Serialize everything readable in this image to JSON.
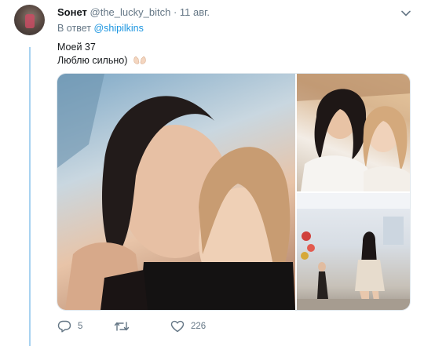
{
  "tweet": {
    "display_name": "Sонет",
    "handle": "@the_lucky_bitch",
    "dot": "·",
    "date": "11 авг.",
    "reply_prefix": "В ответ",
    "reply_handle": "@shipilkins",
    "text_line1": "Моей 37",
    "text_line2": "Люблю сильно)"
  },
  "icons": {
    "more": "chevron-down-icon",
    "reply": "reply-icon",
    "retweet": "retweet-icon",
    "like": "heart-icon",
    "emoji": "open-hands-emoji"
  },
  "actions": {
    "reply_count": "5",
    "retweet_count": "",
    "like_count": "226"
  },
  "colors": {
    "link": "#1b95e0",
    "muted": "#657786",
    "thread_line": "#a8d2f0"
  }
}
